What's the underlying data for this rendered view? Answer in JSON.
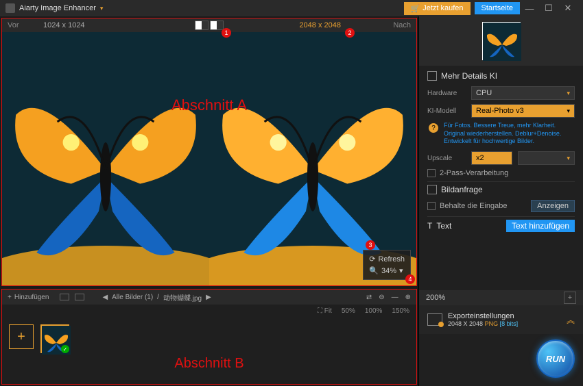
{
  "titlebar": {
    "app_name": "Aiarty Image Enhancer",
    "buy_label": "Jetzt kaufen",
    "home_label": "Startseite"
  },
  "preview": {
    "before_label": "Vor",
    "after_label": "Nach",
    "before_dim": "1024 x 1024",
    "after_dim": "2048 x 2048",
    "section_a": "Abschnitt A",
    "refresh_label": "Refresh",
    "zoom_value": "34%",
    "markers": {
      "m1": "1",
      "m2": "2",
      "m3": "3",
      "m4": "4"
    }
  },
  "strip": {
    "add_label": "Hinzufügen",
    "file_nav_label": "Alle Bilder (1)",
    "file_name": "动物蝴蝶.jpg",
    "fit_label": "Fit",
    "z50": "50%",
    "z100": "100%",
    "z150": "150%",
    "section_b": "Abschnitt B"
  },
  "panel": {
    "details_title": "Mehr Details KI",
    "hardware_label": "Hardware",
    "hardware_value": "CPU",
    "model_label": "KI-Modell",
    "model_value": "Real-Photo v3",
    "model_desc": "Für Fotos. Bessere Treue, mehr Klarheit. Original wiederherstellen. Deblur+Denoise. Entwickelt für hochwertige Bilder.",
    "upscale_label": "Upscale",
    "upscale_value": "x2",
    "two_pass_label": "2-Pass-Verarbeitung",
    "image_query_title": "Bildanfrage",
    "keep_input_label": "Behalte die Eingabe",
    "show_btn": "Anzeigen",
    "text_title": "Text",
    "add_text_btn": "Text hinzufügen",
    "zoom_200": "200%"
  },
  "export": {
    "title": "Exporteinstellungen",
    "dims": "2048 X 2048",
    "format": "PNG",
    "bits": "[8 bits]"
  },
  "run": {
    "label": "RUN"
  }
}
